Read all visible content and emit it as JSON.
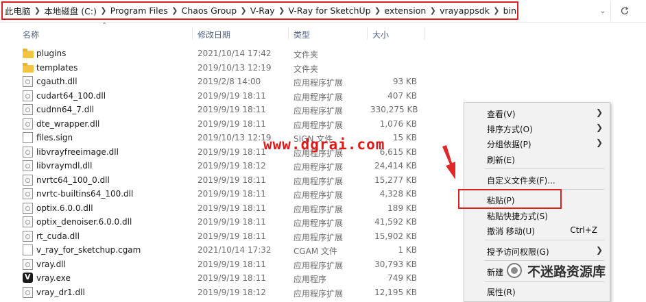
{
  "address": {
    "crumbs": [
      "此电脑",
      "本地磁盘 (C:)",
      "Program Files",
      "Chaos Group",
      "V-Ray",
      "V-Ray for SketchUp",
      "extension",
      "vrayappsdk",
      "bin"
    ]
  },
  "columns": {
    "name": "名称",
    "date": "修改日期",
    "type": "类型",
    "size": "大小"
  },
  "files": [
    {
      "name": "plugins",
      "date": "2021/10/14 17:42",
      "type": "文件夹",
      "size": "",
      "icon": "folder"
    },
    {
      "name": "templates",
      "date": "2019/10/13 12:19",
      "type": "文件夹",
      "size": "",
      "icon": "folder"
    },
    {
      "name": "cgauth.dll",
      "date": "2019/2/8 14:00",
      "type": "应用程序扩展",
      "size": "93 KB",
      "icon": "dll"
    },
    {
      "name": "cudart64_100.dll",
      "date": "2019/9/19 18:11",
      "type": "应用程序扩展",
      "size": "407 KB",
      "icon": "dll"
    },
    {
      "name": "cudnn64_7.dll",
      "date": "2019/9/19 18:11",
      "type": "应用程序扩展",
      "size": "330,275 KB",
      "icon": "dll"
    },
    {
      "name": "dte_wrapper.dll",
      "date": "2019/9/19 18:11",
      "type": "应用程序扩展",
      "size": "1,076 KB",
      "icon": "dll"
    },
    {
      "name": "files.sign",
      "date": "2019/10/13 12:19",
      "type": "SIGN 文件",
      "size": "15 KB",
      "icon": "file"
    },
    {
      "name": "libvrayfreeimage.dll",
      "date": "2019/9/19 18:11",
      "type": "应用程序扩展",
      "size": "6,615 KB",
      "icon": "dll"
    },
    {
      "name": "libvraymdl.dll",
      "date": "2019/9/19 18:12",
      "type": "应用程序扩展",
      "size": "24,414 KB",
      "icon": "dll"
    },
    {
      "name": "nvrtc64_100_0.dll",
      "date": "2019/9/19 18:11",
      "type": "应用程序扩展",
      "size": "15,277 KB",
      "icon": "dll"
    },
    {
      "name": "nvrtc-builtins64_100.dll",
      "date": "2019/9/19 18:11",
      "type": "应用程序扩展",
      "size": "4,328 KB",
      "icon": "dll"
    },
    {
      "name": "optix.6.0.0.dll",
      "date": "2019/9/19 18:11",
      "type": "应用程序扩展",
      "size": "189 KB",
      "icon": "dll"
    },
    {
      "name": "optix_denoiser.6.0.0.dll",
      "date": "2019/9/19 18:11",
      "type": "应用程序扩展",
      "size": "41,592 KB",
      "icon": "dll"
    },
    {
      "name": "rt_cuda.dll",
      "date": "2019/9/19 18:11",
      "type": "应用程序扩展",
      "size": "15,902 KB",
      "icon": "dll"
    },
    {
      "name": "v_ray_for_sketchup.cgam",
      "date": "2021/10/14 17:32",
      "type": "CGAM 文件",
      "size": "1 KB",
      "icon": "file"
    },
    {
      "name": "vray.dll",
      "date": "2019/9/19 18:11",
      "type": "应用程序扩展",
      "size": "30,793 KB",
      "icon": "dll"
    },
    {
      "name": "vray.exe",
      "date": "2019/9/19 18:11",
      "type": "应用程序",
      "size": "749 KB",
      "icon": "exe"
    },
    {
      "name": "vray_dr1.dll",
      "date": "2019/9/19 18:12",
      "type": "应用程序扩展",
      "size": "12,195 KB",
      "icon": "dll"
    }
  ],
  "watermark": "www.dgrai.com",
  "context_menu": {
    "view": "查看(V)",
    "sort": "排序方式(O)",
    "group": "分组依据(P)",
    "refresh": "刷新(E)",
    "customize": "自定义文件夹(F)...",
    "paste": "粘贴(P)",
    "paste_shortcut": "粘贴快捷方式(S)",
    "undo": "撤消 移动(U)",
    "undo_shortcut": "Ctrl+Z",
    "grant_access": "授予访问权限(G)",
    "new": "新建",
    "properties": "属性(R)"
  },
  "brand": "不迷路资源库",
  "colors": {
    "highlight_red": "#e02020",
    "header_text": "#4d6082",
    "folder_yellow": "#f4c542"
  }
}
